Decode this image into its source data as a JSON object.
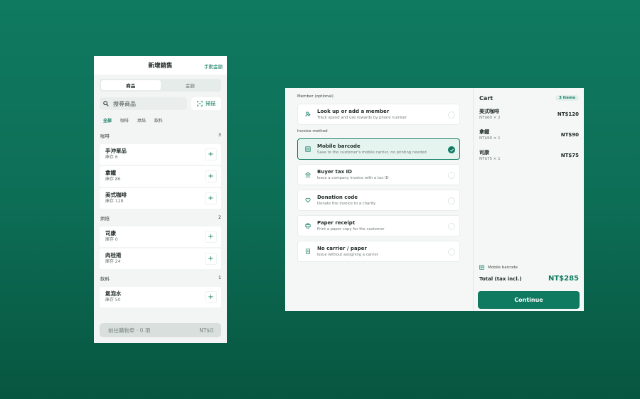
{
  "sale": {
    "title": "新增銷售",
    "manual_amount": "手動金額",
    "tabs": [
      "商品",
      "金額"
    ],
    "search_placeholder": "搜尋商品",
    "scan_label": "掃描",
    "chips": [
      "全部",
      "咖啡",
      "烘焙",
      "飲料"
    ],
    "categories": [
      {
        "name": "咖啡",
        "count": "3",
        "items": [
          {
            "name": "手沖單品",
            "stock": "庫存 6"
          },
          {
            "name": "拿鐵",
            "stock": "庫存 86"
          },
          {
            "name": "美式咖啡",
            "stock": "庫存 128"
          }
        ]
      },
      {
        "name": "烘焙",
        "count": "2",
        "items": [
          {
            "name": "司康",
            "stock": "庫存 0"
          },
          {
            "name": "肉桂捲",
            "stock": "庫存 24"
          }
        ]
      },
      {
        "name": "飲料",
        "count": "1",
        "items": [
          {
            "name": "氣泡水",
            "stock": "庫存 50"
          }
        ]
      }
    ],
    "cart_button": "前往購物車 · 0 項",
    "cart_total": "NT$0"
  },
  "checkout": {
    "member_label": "Member (optional)",
    "member_option": {
      "title": "Look up or add a member",
      "sub": "Track spend and use rewards by phone number"
    },
    "invoice_label": "Invoice method",
    "invoice_options": [
      {
        "title": "Mobile barcode",
        "sub": "Save to the customer's mobile carrier, no printing needed",
        "selected": true
      },
      {
        "title": "Buyer tax ID",
        "sub": "Issue a company invoice with a tax ID",
        "selected": false
      },
      {
        "title": "Donation code",
        "sub": "Donate the invoice to a charity",
        "selected": false
      },
      {
        "title": "Paper receipt",
        "sub": "Print a paper copy for the customer",
        "selected": false
      },
      {
        "title": "No carrier / paper",
        "sub": "Issue without assigning a carrier",
        "selected": false
      }
    ],
    "cart": {
      "title": "Cart",
      "badge": "3 items",
      "rows": [
        {
          "name": "美式咖啡",
          "qty": "NT$60 × 2",
          "price": "NT$120"
        },
        {
          "name": "拿鐵",
          "qty": "NT$90 × 1",
          "price": "NT$90"
        },
        {
          "name": "司康",
          "qty": "NT$75 × 1",
          "price": "NT$75"
        }
      ],
      "carrier": "Mobile barcode",
      "total_label": "Total (tax incl.)",
      "total_value": "NT$285",
      "continue_label": "Continue"
    }
  },
  "colors": {
    "accent": "#0f7a60",
    "background": "#0d6e56"
  }
}
